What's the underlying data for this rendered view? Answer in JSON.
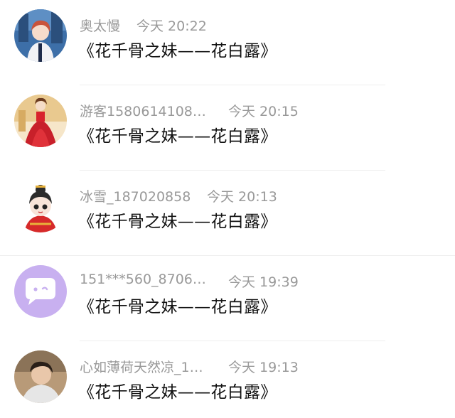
{
  "items": [
    {
      "name": "奥太慢",
      "time": "今天 20:22",
      "message": "《花千骨之妹——花白露》",
      "avatar": "avatar-anime-boy"
    },
    {
      "name": "游客1580614108…",
      "time": "今天 20:15",
      "message": "《花千骨之妹——花白露》",
      "avatar": "avatar-red-gown-girl"
    },
    {
      "name": "冰雪_187020858",
      "time": "今天 20:13",
      "message": "《花千骨之妹——花白露》",
      "avatar": "avatar-chibi-bride"
    },
    {
      "name": "151***560_8706…",
      "time": "今天 19:39",
      "message": "《花千骨之妹——花白露》",
      "avatar": "avatar-chat-bubble-icon"
    },
    {
      "name": "心如薄荷天然凉_1…",
      "time": "今天 19:13",
      "message": "《花千骨之妹——花白露》",
      "avatar": "avatar-photo-boy"
    }
  ],
  "colors": {
    "name_gray": "#999999",
    "message": "#111111",
    "divider": "#efefef",
    "bubble_bg": "#c8b0f0"
  }
}
